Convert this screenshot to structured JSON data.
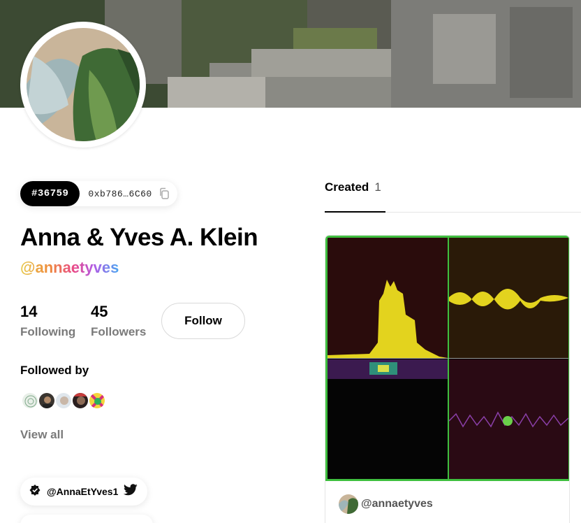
{
  "profile": {
    "token_id": "#36759",
    "address": "0xb786…6C60",
    "name": "Anna & Yves A. Klein",
    "handle": "@annaetyves",
    "following_count": "14",
    "following_label": "Following",
    "followers_count": "45",
    "followers_label": "Followers",
    "follow_button": "Follow",
    "followed_by_label": "Followed by",
    "view_all_label": "View all",
    "twitter_handle": "@AnnaEtYves1"
  },
  "tabs": [
    {
      "label": "Created",
      "count": "1"
    }
  ],
  "card": {
    "creator_handle": "@annaetyves"
  },
  "colors": {
    "accent_border": "#3fbf3f",
    "handle_gradient": [
      "#e7c94a",
      "#ef8a3c",
      "#e8488a",
      "#b05ce6",
      "#4aa6f0"
    ]
  }
}
